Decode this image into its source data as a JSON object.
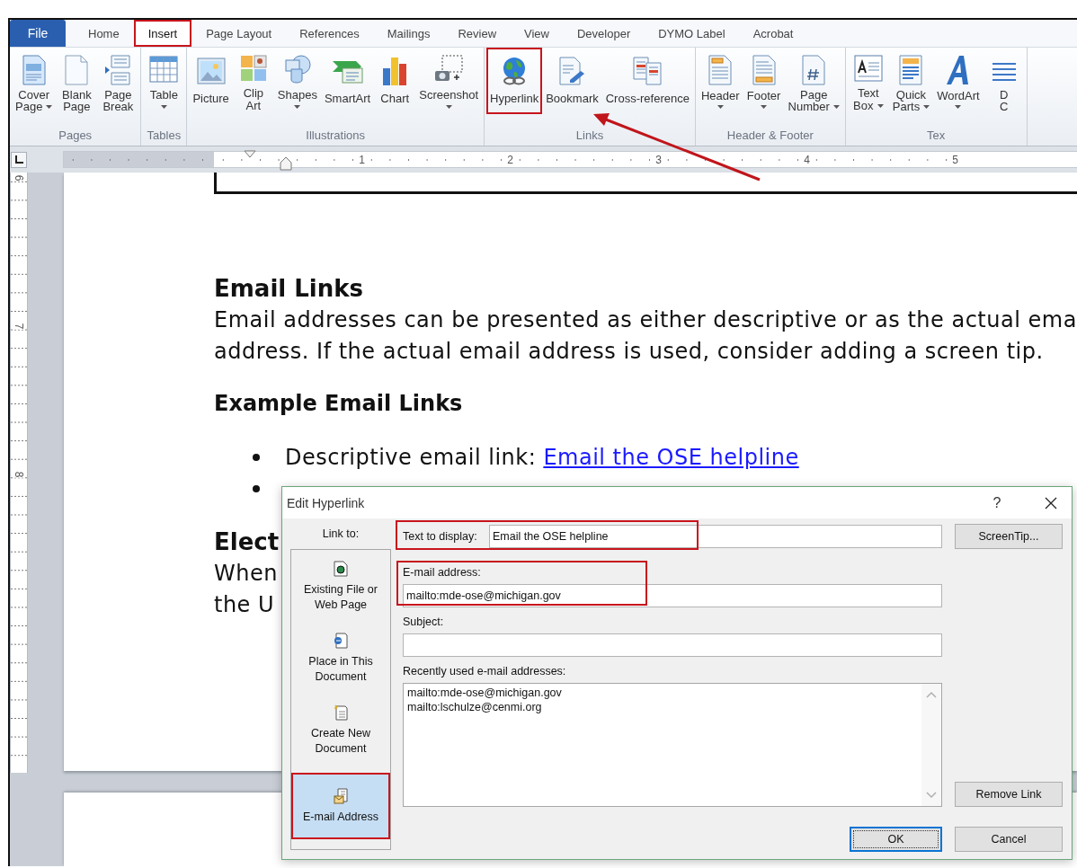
{
  "tabs": [
    {
      "label": "File",
      "kind": "file",
      "selected": false,
      "highlighted": false
    },
    {
      "label": "Home",
      "kind": "tab",
      "selected": false,
      "highlighted": false
    },
    {
      "label": "Insert",
      "kind": "tab",
      "selected": true,
      "highlighted": true
    },
    {
      "label": "Page Layout",
      "kind": "tab",
      "selected": false,
      "highlighted": false
    },
    {
      "label": "References",
      "kind": "tab",
      "selected": false,
      "highlighted": false
    },
    {
      "label": "Mailings",
      "kind": "tab",
      "selected": false,
      "highlighted": false
    },
    {
      "label": "Review",
      "kind": "tab",
      "selected": false,
      "highlighted": false
    },
    {
      "label": "View",
      "kind": "tab",
      "selected": false,
      "highlighted": false
    },
    {
      "label": "Developer",
      "kind": "tab",
      "selected": false,
      "highlighted": false
    },
    {
      "label": "DYMO Label",
      "kind": "tab",
      "selected": false,
      "highlighted": false
    },
    {
      "label": "Acrobat",
      "kind": "tab",
      "selected": false,
      "highlighted": false
    }
  ],
  "ribbon": {
    "groups": [
      {
        "label": "Pages",
        "buttons": [
          {
            "lines": [
              "Cover",
              "Page"
            ],
            "dropdown": true,
            "highlighted": false
          },
          {
            "lines": [
              "Blank",
              "Page"
            ],
            "dropdown": false,
            "highlighted": false
          },
          {
            "lines": [
              "Page",
              "Break"
            ],
            "dropdown": false,
            "highlighted": false
          }
        ]
      },
      {
        "label": "Tables",
        "buttons": [
          {
            "lines": [
              "Table"
            ],
            "dropdown": true,
            "highlighted": false
          }
        ]
      },
      {
        "label": "Illustrations",
        "buttons": [
          {
            "lines": [
              "Picture"
            ],
            "dropdown": false,
            "highlighted": false
          },
          {
            "lines": [
              "Clip",
              "Art"
            ],
            "dropdown": false,
            "highlighted": false
          },
          {
            "lines": [
              "Shapes"
            ],
            "dropdown": true,
            "highlighted": false
          },
          {
            "lines": [
              "SmartArt"
            ],
            "dropdown": false,
            "highlighted": false
          },
          {
            "lines": [
              "Chart"
            ],
            "dropdown": false,
            "highlighted": false
          },
          {
            "lines": [
              "Screenshot"
            ],
            "dropdown": true,
            "highlighted": false
          }
        ]
      },
      {
        "label": "Links",
        "buttons": [
          {
            "lines": [
              "Hyperlink"
            ],
            "dropdown": false,
            "highlighted": true
          },
          {
            "lines": [
              "Bookmark"
            ],
            "dropdown": false,
            "highlighted": false
          },
          {
            "lines": [
              "Cross-reference"
            ],
            "dropdown": false,
            "highlighted": false
          }
        ]
      },
      {
        "label": "Header & Footer",
        "buttons": [
          {
            "lines": [
              "Header"
            ],
            "dropdown": true,
            "highlighted": false
          },
          {
            "lines": [
              "Footer"
            ],
            "dropdown": true,
            "highlighted": false
          },
          {
            "lines": [
              "Page",
              "Number"
            ],
            "dropdown": true,
            "highlighted": false
          }
        ]
      },
      {
        "label": "Tex",
        "buttons": [
          {
            "lines": [
              "Text",
              "Box"
            ],
            "dropdown": true,
            "highlighted": false
          },
          {
            "lines": [
              "Quick",
              "Parts"
            ],
            "dropdown": true,
            "highlighted": false
          },
          {
            "lines": [
              "WordArt"
            ],
            "dropdown": true,
            "highlighted": false
          },
          {
            "lines": [
              "D",
              "C"
            ],
            "dropdown": false,
            "highlighted": false
          }
        ]
      }
    ]
  },
  "rulers": {
    "horizontal": [
      "1",
      "2",
      "3",
      "4",
      "5"
    ],
    "vertical": [
      "6",
      "7",
      "8"
    ]
  },
  "document": {
    "blocks": [
      {
        "kind": "heading",
        "text": "Email Links"
      },
      {
        "kind": "paragraph",
        "lines": [
          "Email addresses can be presented as either descriptive or as the actual ema",
          "address. If the actual email address is used, consider adding a screen tip."
        ]
      },
      {
        "kind": "subheading",
        "text": "Example Email Links"
      },
      {
        "kind": "bullets",
        "items": [
          {
            "kind": "text",
            "text": "Descriptive email link: ",
            "link": "Email the OSE helpline"
          },
          {
            "kind": "covered"
          }
        ]
      },
      {
        "kind": "heading",
        "text": "Elect"
      },
      {
        "kind": "paragraph",
        "lines": [
          "When",
          "the U"
        ]
      }
    ]
  },
  "dialog": {
    "title": "Edit Hyperlink",
    "help": "?",
    "link_to_label": "Link to:",
    "link_to": [
      {
        "label": "Existing File or Web Page",
        "selected": false,
        "highlighted": false
      },
      {
        "label": "Place in This Document",
        "selected": false,
        "highlighted": false
      },
      {
        "label": "Create New Document",
        "selected": false,
        "highlighted": false
      },
      {
        "label": "E-mail Address",
        "selected": true,
        "highlighted": true
      }
    ],
    "text_to_display": {
      "label": "Text to display:",
      "value": "Email the OSE helpline",
      "highlighted": true
    },
    "email": {
      "label": "E-mail address:",
      "value": "mailto:mde-ose@michigan.gov",
      "highlighted": true
    },
    "subject": {
      "label": "Subject:"
    },
    "recent": {
      "label": "Recently used e-mail addresses:",
      "items": [
        "mailto:mde-ose@michigan.gov",
        "mailto:lschulze@cenmi.org"
      ]
    },
    "buttons": {
      "screentip": "ScreenTip...",
      "remove": "Remove Link",
      "ok": "OK",
      "cancel": "Cancel"
    }
  }
}
